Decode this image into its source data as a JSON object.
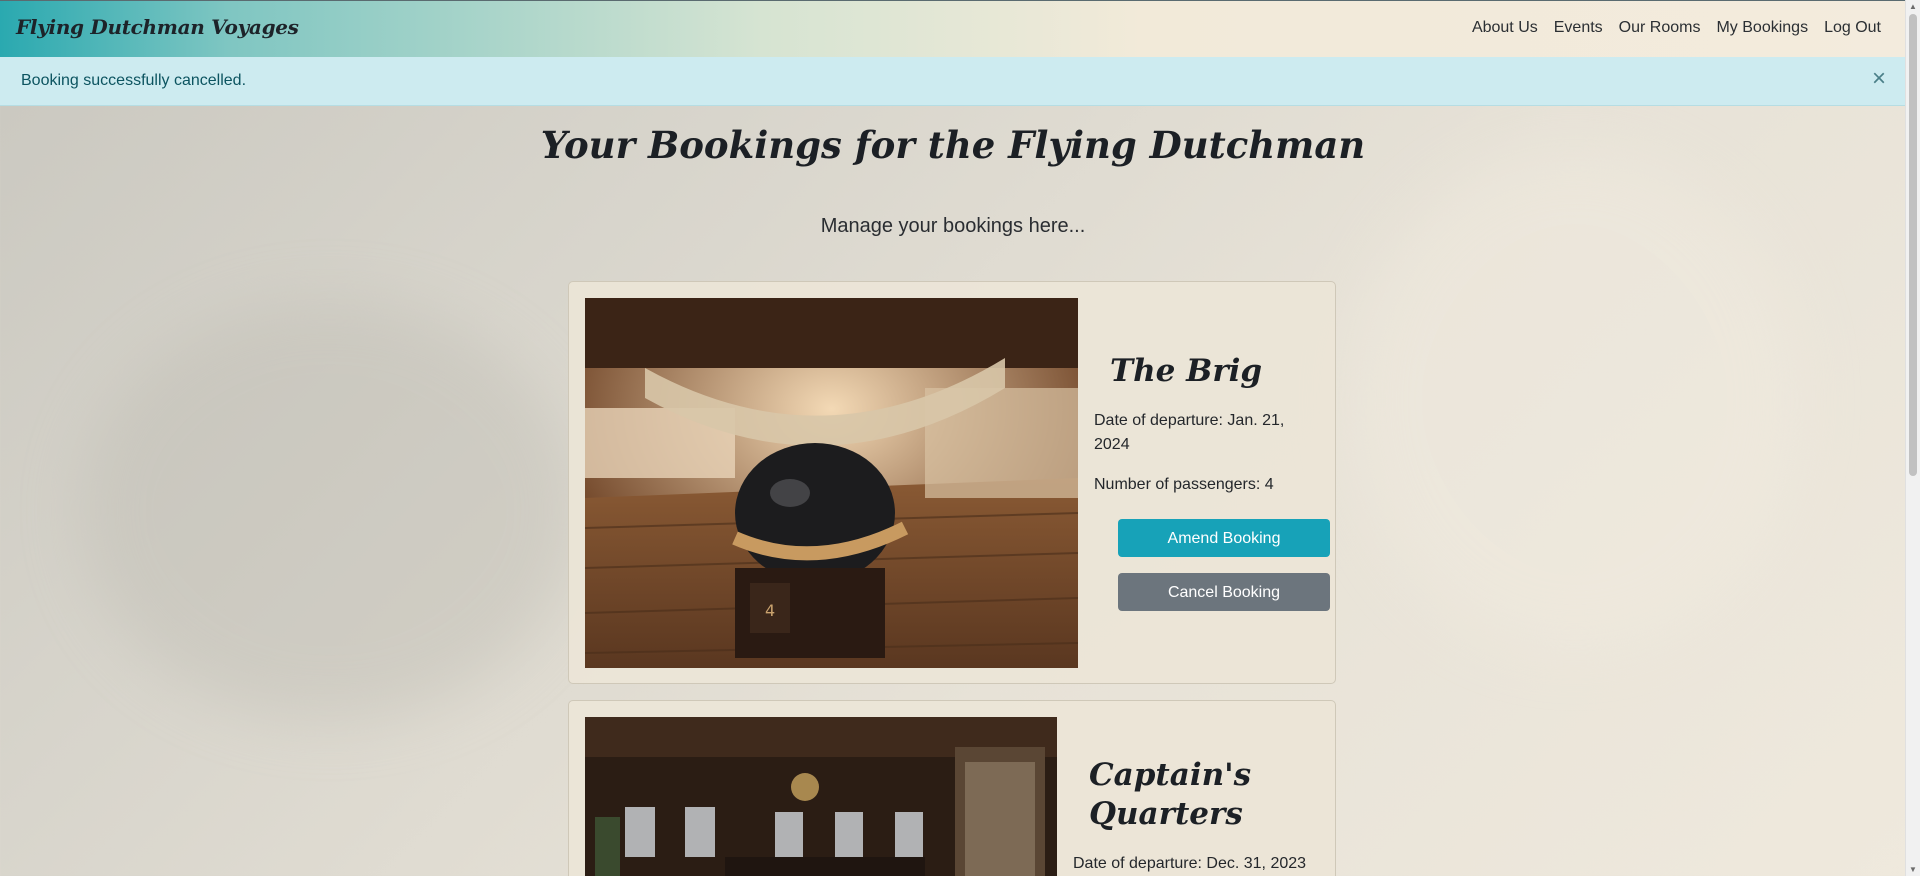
{
  "navbar": {
    "brand": "Flying Dutchman Voyages",
    "links": [
      "About Us",
      "Events",
      "Our Rooms",
      "My Bookings",
      "Log Out"
    ]
  },
  "alert": {
    "message": "Booking successfully cancelled.",
    "close_symbol": "×"
  },
  "page": {
    "title": "Your Bookings for the Flying Dutchman",
    "subtitle": "Manage your bookings here..."
  },
  "bookings": [
    {
      "room": "The Brig",
      "departure": "Date of departure: Jan. 21, 2024",
      "passengers": "Number of passengers: 4",
      "amend_label": "Amend Booking",
      "cancel_label": "Cancel Booking"
    },
    {
      "room": "Captain's Quarters",
      "departure": "Date of departure: Dec. 31, 2023"
    }
  ],
  "colors": {
    "amend": "#17a2b8",
    "cancel": "#6c757d",
    "alert_bg": "#cdebf0",
    "alert_text": "#0c5460"
  }
}
